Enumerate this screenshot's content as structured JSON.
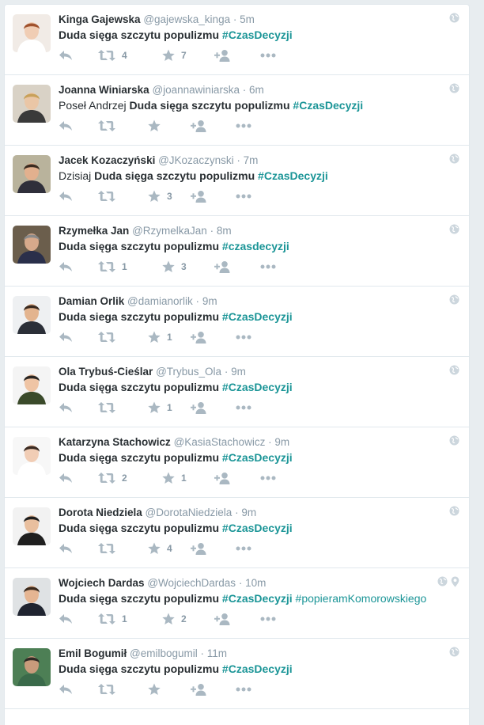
{
  "tweets": [
    {
      "name": "Kinga Gajewska",
      "handle": "@gajewska_kinga",
      "time": "5m",
      "prefix": "",
      "bold_text": "Duda sięga szczytu populizmu",
      "hashtag": "#CzasDecyzji",
      "extra_hashtag": "",
      "retweets": "4",
      "favorites": "7",
      "geo": false
    },
    {
      "name": "Joanna Winiarska",
      "handle": "@joannawiniarska",
      "time": "6m",
      "prefix": "Poseł Andrzej ",
      "bold_text": "Duda sięga szczytu populizmu",
      "hashtag": "#CzasDecyzji",
      "extra_hashtag": "",
      "retweets": "",
      "favorites": "",
      "geo": false
    },
    {
      "name": "Jacek Kozaczyński",
      "handle": "@JKozaczynski",
      "time": "7m",
      "prefix": "Dzisiaj ",
      "bold_text": "Duda sięga szczytu populizmu",
      "hashtag": "#CzasDecyzji",
      "extra_hashtag": "",
      "retweets": "",
      "favorites": "3",
      "geo": false
    },
    {
      "name": "Rzymełka Jan",
      "handle": "@RzymelkaJan",
      "time": "8m",
      "prefix": "",
      "bold_text": "Duda sięga szczytu populizmu",
      "hashtag": "#czasdecyzji",
      "extra_hashtag": "",
      "retweets": "1",
      "favorites": "3",
      "geo": false
    },
    {
      "name": "Damian Orlik",
      "handle": "@damianorlik",
      "time": "9m",
      "prefix": "",
      "bold_text": "Duda siega szczytu populizmu",
      "hashtag": "#CzasDecyzji",
      "extra_hashtag": "",
      "retweets": "",
      "favorites": "1",
      "geo": false
    },
    {
      "name": "Ola Trybuś-Cieślar",
      "handle": "@Trybus_Ola",
      "time": "9m",
      "prefix": "",
      "bold_text": "Duda sięga szczytu populizmu",
      "hashtag": "#CzasDecyzji",
      "extra_hashtag": "",
      "retweets": "",
      "favorites": "1",
      "geo": false
    },
    {
      "name": "Katarzyna Stachowicz",
      "handle": "@KasiaStachowicz",
      "time": "9m",
      "prefix": "",
      "bold_text": "Duda sięga szczytu populizmu",
      "hashtag": "#CzasDecyzji",
      "extra_hashtag": "",
      "retweets": "2",
      "favorites": "1",
      "geo": false
    },
    {
      "name": "Dorota Niedziela",
      "handle": "@DorotaNiedziela",
      "time": "9m",
      "prefix": "",
      "bold_text": "Duda sięga szczytu populizmu",
      "hashtag": "#CzasDecyzji",
      "extra_hashtag": "",
      "retweets": "",
      "favorites": "4",
      "geo": false
    },
    {
      "name": "Wojciech Dardas",
      "handle": "@WojciechDardas",
      "time": "10m",
      "prefix": "",
      "bold_text": "Duda sięga szczytu populizmu",
      "hashtag": "#CzasDecyzji",
      "extra_hashtag": "#popieramKomorowskiego",
      "retweets": "1",
      "favorites": "2",
      "geo": true
    },
    {
      "name": "Emil Bogumił",
      "handle": "@emilbogumil",
      "time": "11m",
      "prefix": "",
      "bold_text": "Duda sięga szczytu populizmu",
      "hashtag": "#CzasDecyzji",
      "extra_hashtag": "",
      "retweets": "",
      "favorites": "",
      "geo": false
    }
  ],
  "separator": "·",
  "icons": {
    "reply": "reply-icon",
    "retweet": "retweet-icon",
    "favorite": "star-icon",
    "follow": "follow-icon",
    "more": "more-icon",
    "globe": "globe-icon",
    "location": "location-pin-icon"
  },
  "colors": {
    "hashtag": "#1b9597",
    "muted": "#8899a6",
    "name": "#292f33",
    "border": "#e1e8ed",
    "icon": "#aab8c2"
  }
}
